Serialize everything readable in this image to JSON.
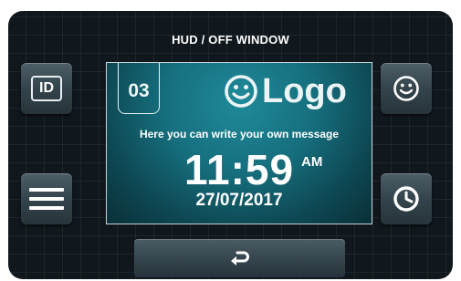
{
  "header": {
    "title": "HUD / OFF WINDOW"
  },
  "left_buttons": {
    "id_label": "ID"
  },
  "screen": {
    "id_number": "03",
    "logo_text": "Logo",
    "message": "Here you can write your own message",
    "time": "11:59",
    "ampm": "AM",
    "date": "27/07/2017"
  },
  "icons": {
    "id": "id-badge-icon",
    "menu": "hamburger-menu-icon",
    "smiley": "smiley-icon",
    "clock": "clock-icon",
    "back": "return-arrow-icon"
  },
  "colors": {
    "screen_teal": "#166f7e",
    "button_gray": "#3a4a52",
    "background": "#10181d"
  }
}
